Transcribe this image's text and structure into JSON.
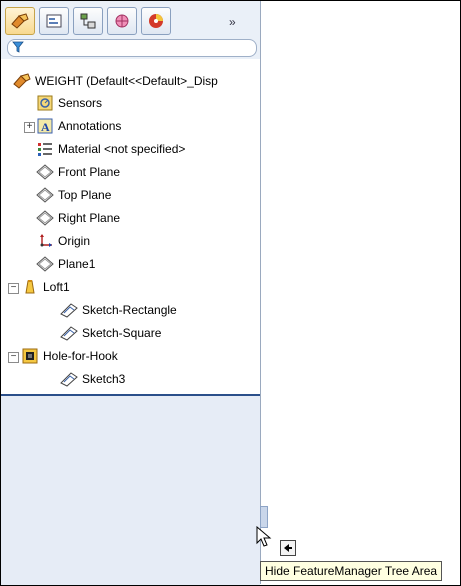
{
  "toolbar": {
    "tabs": [
      {
        "name": "featuremanager-tab",
        "icon": "featuremanager-icon",
        "active": true
      },
      {
        "name": "propertymanager-tab",
        "icon": "propertymanager-icon"
      },
      {
        "name": "configurationmanager-tab",
        "icon": "configurationmanager-icon"
      },
      {
        "name": "dimxpert-tab",
        "icon": "dimxpert-icon"
      },
      {
        "name": "display-manager-tab",
        "icon": "display-manager-icon"
      }
    ],
    "more": "»"
  },
  "tree": {
    "root": "WEIGHT (Default<<Default>_Disp",
    "items": [
      {
        "label": "Sensors",
        "icon": "sensors-icon"
      },
      {
        "label": "Annotations",
        "icon": "annotations-icon",
        "expand": "+"
      },
      {
        "label": "Material <not specified>",
        "icon": "material-icon"
      },
      {
        "label": "Front Plane",
        "icon": "plane-icon"
      },
      {
        "label": "Top Plane",
        "icon": "plane-icon"
      },
      {
        "label": "Right Plane",
        "icon": "plane-icon"
      },
      {
        "label": "Origin",
        "icon": "origin-icon"
      },
      {
        "label": "Plane1",
        "icon": "plane-icon"
      },
      {
        "label": "Loft1",
        "icon": "loft-icon",
        "expand": "−"
      },
      {
        "label": "Sketch-Rectangle",
        "icon": "sketch-icon"
      },
      {
        "label": "Sketch-Square",
        "icon": "sketch-icon"
      },
      {
        "label": "Hole-for-Hook",
        "icon": "hole-icon",
        "expand": "−"
      },
      {
        "label": "Sketch3",
        "icon": "sketch-icon"
      }
    ]
  },
  "tooltip": "Hide FeatureManager Tree Area",
  "colors": {
    "panel": "#eaf0f8",
    "accent": "#2b4f8a",
    "tooltip_bg": "#ffffe1"
  }
}
